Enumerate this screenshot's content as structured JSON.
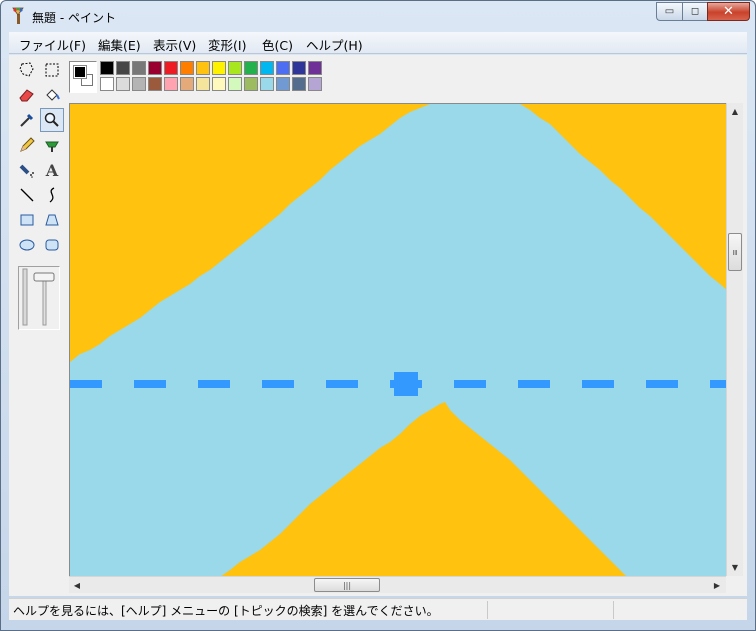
{
  "window": {
    "title": "無題 - ペイント",
    "controls": {
      "minimize": "▭",
      "maximize": "◻",
      "close": "✕"
    }
  },
  "menu": [
    {
      "label": "ファイル(F)"
    },
    {
      "label": "編集(E)"
    },
    {
      "label": "表示(V)"
    },
    {
      "label": "変形(I)"
    },
    {
      "label": "色(C)"
    },
    {
      "label": "ヘルプ(H)"
    }
  ],
  "tools": [
    {
      "name": "free-select-tool",
      "icon": "free-form-select-icon"
    },
    {
      "name": "rect-select-tool",
      "icon": "select-icon"
    },
    {
      "name": "eraser-tool",
      "icon": "eraser-icon"
    },
    {
      "name": "fill-tool",
      "icon": "fill-bucket-icon"
    },
    {
      "name": "color-picker-tool",
      "icon": "eyedropper-icon"
    },
    {
      "name": "magnifier-tool",
      "icon": "magnifier-icon",
      "selected": true
    },
    {
      "name": "pencil-tool",
      "icon": "pencil-icon"
    },
    {
      "name": "brush-tool",
      "icon": "brush-icon"
    },
    {
      "name": "airbrush-tool",
      "icon": "airbrush-icon"
    },
    {
      "name": "text-tool",
      "icon": "text-icon",
      "glyph": "A"
    },
    {
      "name": "line-tool",
      "icon": "line-icon"
    },
    {
      "name": "curve-tool",
      "icon": "curve-icon"
    },
    {
      "name": "rectangle-tool",
      "icon": "rectangle-icon"
    },
    {
      "name": "polygon-tool",
      "icon": "polygon-icon"
    },
    {
      "name": "ellipse-tool",
      "icon": "ellipse-icon"
    },
    {
      "name": "rounded-rect-tool",
      "icon": "rounded-rectangle-icon"
    }
  ],
  "colors": {
    "foreground": "#000000",
    "background": "#ffffff",
    "palette_top": [
      "#000000",
      "#464646",
      "#787878",
      "#990030",
      "#ed1c24",
      "#ff7e00",
      "#ffc20e",
      "#fff200",
      "#a8e61d",
      "#22b14c",
      "#00b7ef",
      "#4d6df3",
      "#2f3699",
      "#6f3198"
    ],
    "palette_bottom": [
      "#ffffff",
      "#dcdcdc",
      "#b4b4b4",
      "#9c5a3c",
      "#ffa3b1",
      "#e5aa7a",
      "#f5e49c",
      "#fff9bd",
      "#d3f9bc",
      "#9dbb61",
      "#99d9ea",
      "#709ad1",
      "#546d8e",
      "#b5a5d5"
    ],
    "image_orange": "#ffc20e",
    "image_blue": "#99d9ea",
    "dash_blue": "#3399ff"
  },
  "scrollbar": {
    "grip": "|||"
  },
  "status": {
    "text": "ヘルプを見るには、[ヘルプ] メニューの [トピックの検索] を選んでください。"
  }
}
